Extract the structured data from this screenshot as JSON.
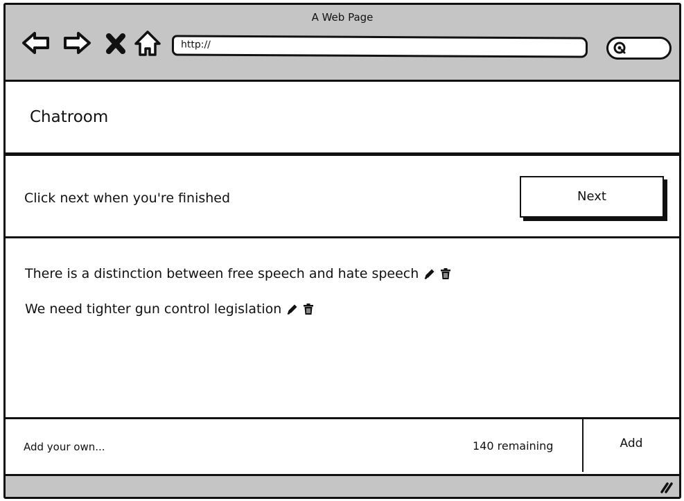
{
  "browser": {
    "window_title": "A Web Page",
    "url": "http://",
    "icons": [
      "back-arrow-icon",
      "forward-arrow-icon",
      "close-x-icon",
      "home-icon",
      "search-icon",
      "resize-grip-icon"
    ]
  },
  "page": {
    "title": "Chatroom",
    "instruction": "Click next when you're finished",
    "next_label": "Next"
  },
  "messages": [
    {
      "text": "There is a distinction between free speech and hate speech"
    },
    {
      "text": "We need tighter gun control legislation"
    }
  ],
  "composer": {
    "placeholder": "Add your own...",
    "remaining": "140 remaining",
    "add_label": "Add"
  },
  "colors": {
    "chrome_bg": "#c5c5c5",
    "border": "#111111",
    "background": "#ffffff"
  }
}
